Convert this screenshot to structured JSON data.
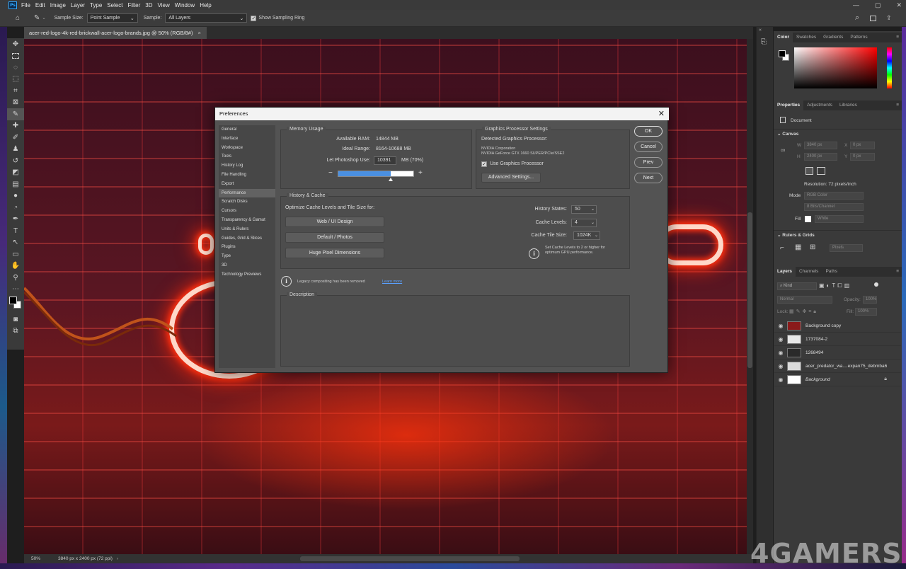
{
  "menu": [
    "File",
    "Edit",
    "Image",
    "Layer",
    "Type",
    "Select",
    "Filter",
    "3D",
    "View",
    "Window",
    "Help"
  ],
  "window_controls": [
    "—",
    "▢",
    "✕"
  ],
  "options_bar": {
    "sample_size_label": "Sample Size:",
    "sample_size_value": "Point Sample",
    "sample_label": "Sample:",
    "sample_value": "All Layers",
    "ring_label": "Show Sampling Ring"
  },
  "document": {
    "tab_title": "acer-red-logo-4k-red-brickwall-acer-logo-brands.jpg @ 50% (RGB/8#)",
    "tab_close": "×",
    "zoom": "50%",
    "doc_info": "3840 px x 2400 px (72 ppi)"
  },
  "color_panel": {
    "tabs": [
      "Color",
      "Swatches",
      "Gradients",
      "Patterns"
    ]
  },
  "properties_panel": {
    "tabs": [
      "Properties",
      "Adjustments",
      "Libraries"
    ],
    "kind": "Document",
    "section_canvas": "Canvas",
    "w_label": "W",
    "w_value": "3840 px",
    "h_label": "H",
    "h_value": "2400 px",
    "x_label": "X",
    "x_value": "0 px",
    "y_label": "Y",
    "y_value": "0 px",
    "resolution": "Resolution: 72 pixels/inch",
    "mode_label": "Mode",
    "mode_value": "RGB Color",
    "bits_value": "8 Bits/Channel",
    "fill_label": "Fill",
    "fill_value": "White",
    "section_rulers": "Rulers & Grids",
    "rulers_unit": "Pixels"
  },
  "layers_panel": {
    "tabs": [
      "Layers",
      "Channels",
      "Paths"
    ],
    "kind_filter": "Kind",
    "blend_mode": "Normal",
    "opacity_label": "Opacity:",
    "opacity_value": "100%",
    "lock_label": "Lock:",
    "fill_label": "Fill:",
    "fill_value": "100%",
    "layers": [
      {
        "name": "Background copy"
      },
      {
        "name": "1737084-2"
      },
      {
        "name": "1268494"
      },
      {
        "name": "acer_predator_wa....expan75_debmba6"
      },
      {
        "name": "Background"
      }
    ]
  },
  "dialog": {
    "title": "Preferences",
    "close": "✕",
    "nav": [
      "General",
      "Interface",
      "Workspace",
      "Tools",
      "History Log",
      "File Handling",
      "Export",
      "Performance",
      "Scratch Disks",
      "Cursors",
      "Transparency & Gamut",
      "Units & Rulers",
      "Guides, Grid & Slices",
      "Plugins",
      "Type",
      "3D",
      "Technology Previews"
    ],
    "nav_active": "Performance",
    "memory": {
      "label": "Memory Usage",
      "available_label": "Available RAM:",
      "available_value": "14844 MB",
      "ideal_label": "Ideal Range:",
      "ideal_value": "8164-10688 MB",
      "let_label": "Let Photoshop Use:",
      "let_value": "10391",
      "let_unit": "MB (70%)",
      "slider_percent": 70,
      "minus": "−",
      "plus": "+"
    },
    "gpu": {
      "label": "Graphics Processor Settings",
      "detected_label": "Detected Graphics Processor:",
      "vendor": "NVIDIA Corporation",
      "model": "NVIDIA GeForce GTX 1660 SUPER/PCIe/SSE2",
      "use_label": "Use Graphics Processor",
      "advanced": "Advanced Settings..."
    },
    "history": {
      "label": "History & Cache",
      "optimize_label": "Optimize Cache Levels and Tile Size for:",
      "buttons": [
        "Web / UI Design",
        "Default / Photos",
        "Huge Pixel Dimensions"
      ],
      "states_label": "History States:",
      "states_value": "50",
      "levels_label": "Cache Levels:",
      "levels_value": "4",
      "tile_label": "Cache Tile Size:",
      "tile_value": "1024K",
      "note_line1": "Set Cache Levels to 2 or higher for",
      "note_line2": "optimum GPU performance."
    },
    "legacy_text": "Legacy compositing has been removed",
    "learn_more": "Learn more",
    "description_label": "Description",
    "side_buttons": [
      "OK",
      "Cancel",
      "Prev",
      "Next"
    ]
  },
  "watermark": "4GAMERS",
  "colors": {
    "accent": "#4a90e2",
    "foreground": "#000000",
    "background": "#ffffff"
  }
}
